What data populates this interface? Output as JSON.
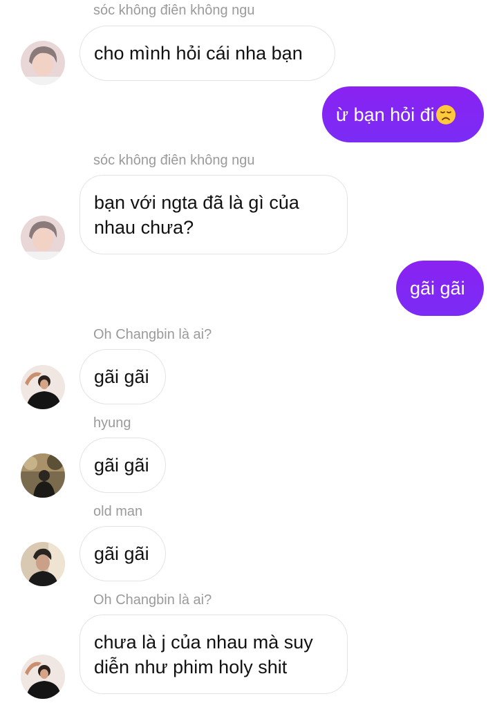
{
  "messages": [
    {
      "sender": "sóc không điên không ngu",
      "text": "cho mình hỏi cái nha bạn",
      "avatar": "user-avatar-photo"
    },
    {
      "outgoing": true,
      "text": "ừ bạn hỏi đi",
      "emoji": "disappointed-face-icon"
    },
    {
      "sender": "sóc không điên không ngu",
      "text": "bạn với ngta đã là gì của nhau chưa?",
      "avatar": "user-avatar-photo"
    },
    {
      "outgoing": true,
      "text": "gãi gãi"
    },
    {
      "sender": "Oh Changbin là ai?",
      "text": "gãi gãi",
      "avatar": "user-avatar-photo"
    },
    {
      "sender": "hyung",
      "text": "gãi gãi",
      "avatar": "user-avatar-photo"
    },
    {
      "sender": "old man",
      "text": "gãi gãi",
      "avatar": "user-avatar-photo"
    },
    {
      "sender": "Oh Changbin là ai?",
      "text": "chưa là j của nhau mà suy diễn như phim holy shit",
      "avatar": "user-avatar-photo"
    }
  ],
  "colors": {
    "outgoing_bubble": "#8a22f2",
    "incoming_border": "#e3e3e3",
    "sender_name": "#9a9a9a"
  }
}
